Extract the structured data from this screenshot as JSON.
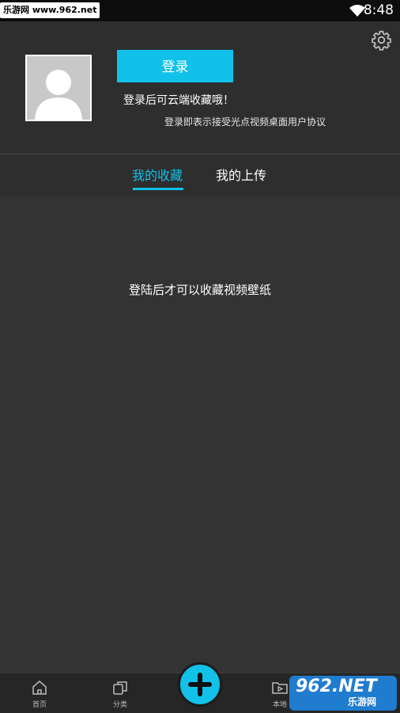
{
  "status_bar": {
    "watermark": "乐游网 www.962.net",
    "time": "8:48"
  },
  "profile": {
    "login_label": "登录",
    "hint": "登录后可云端收藏哦！",
    "agreement": "登录即表示接受光点视频桌面用户协议"
  },
  "tabs": [
    {
      "label": "我的收藏",
      "active": true
    },
    {
      "label": "我的上传",
      "active": false
    }
  ],
  "content": {
    "empty_message": "登陆后才可以收藏视频壁纸"
  },
  "bottom_nav": {
    "items": [
      {
        "label": "首页",
        "icon": "home-icon"
      },
      {
        "label": "分类",
        "icon": "category-icon"
      },
      {
        "label": "本地",
        "icon": "local-video-icon"
      }
    ],
    "add_icon": "plus-icon"
  },
  "watermark_bottom": {
    "main": "962.NET",
    "sub": "乐游网"
  },
  "colors": {
    "accent": "#11c1ea",
    "background": "#2e2e2e"
  }
}
